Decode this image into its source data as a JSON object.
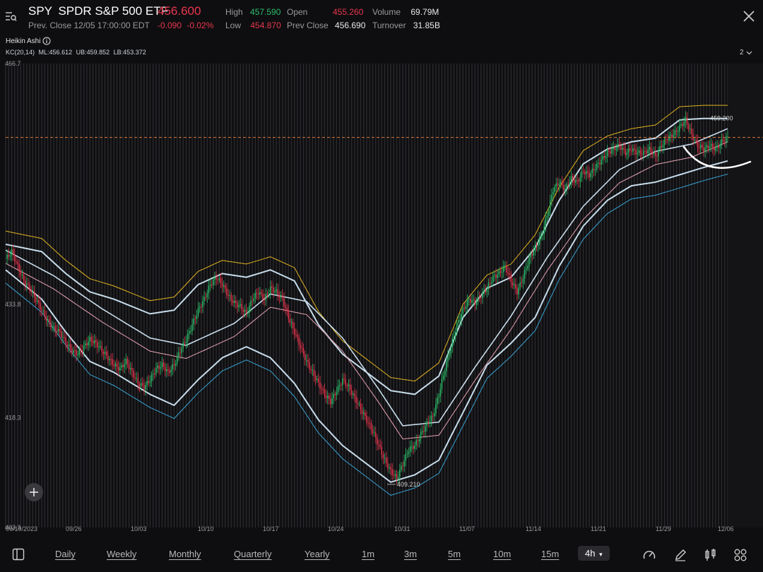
{
  "header": {
    "ticker": "SPY",
    "name": "SPDR S&P 500 ETF",
    "price": "456.600",
    "prev_close_text": "Prev. Close 12/05 17:00:00 EDT",
    "change": "-0.090",
    "change_pct": "-0.02%",
    "stats": {
      "high_label": "High",
      "high": "457.590",
      "low_label": "Low",
      "low": "454.870",
      "open_label": "Open",
      "open": "455.260",
      "prev_close_label": "Prev Close",
      "prev_close": "456.690",
      "volume_label": "Volume",
      "volume": "69.79M",
      "turnover_label": "Turnover",
      "turnover": "31.85B"
    }
  },
  "indicators": {
    "heikin_label": "Heikin Ashi",
    "kc_name": "KC(20,14)",
    "kc_ml": "ML:456.612",
    "kc_ub": "UB:459.852",
    "kc_lb": "LB:453.372",
    "pane_count": "2"
  },
  "chart_data": {
    "type": "candlestick",
    "style": "Heikin Ashi",
    "interval": "4h",
    "y_ticks": [
      "466.7",
      "433.8",
      "418.3",
      "403.3"
    ],
    "y_tick_values": [
      466.7,
      433.8,
      418.3,
      403.3
    ],
    "ylim": [
      403.3,
      466.7
    ],
    "x_ticks": [
      "09/19/2023",
      "09/26",
      "10/03",
      "10/10",
      "10/17",
      "10/24",
      "10/31",
      "11/07",
      "11/14",
      "11/21",
      "11/29",
      "12/06"
    ],
    "price_line": 456.6,
    "annotations": {
      "max_label": "459.200",
      "min_label": "409.210"
    },
    "close_path": [
      [
        0,
        440
      ],
      [
        1,
        441
      ],
      [
        2,
        439
      ],
      [
        3,
        437
      ],
      [
        4,
        436
      ],
      [
        5,
        434.5
      ],
      [
        6,
        433
      ],
      [
        7,
        431.5
      ],
      [
        8,
        430.5
      ],
      [
        9,
        430
      ],
      [
        10,
        428.5
      ],
      [
        11,
        427.5
      ],
      [
        12,
        427
      ],
      [
        13,
        428
      ],
      [
        14,
        429
      ],
      [
        15,
        428.5
      ],
      [
        16,
        427.5
      ],
      [
        17,
        426.5
      ],
      [
        18,
        425.5
      ],
      [
        19,
        425
      ],
      [
        20,
        426
      ],
      [
        21,
        424.5
      ],
      [
        22,
        423
      ],
      [
        23,
        422.5
      ],
      [
        24,
        423.5
      ],
      [
        25,
        425
      ],
      [
        26,
        425.5
      ],
      [
        27,
        424.5
      ],
      [
        28,
        425.5
      ],
      [
        29,
        427.5
      ],
      [
        30,
        429
      ],
      [
        31,
        431
      ],
      [
        32,
        433
      ],
      [
        33,
        434.5
      ],
      [
        34,
        436.5
      ],
      [
        35,
        437.5
      ],
      [
        36,
        436.5
      ],
      [
        37,
        435
      ],
      [
        38,
        434
      ],
      [
        39,
        433.5
      ],
      [
        40,
        432.5
      ],
      [
        41,
        434.5
      ],
      [
        42,
        435.5
      ],
      [
        43,
        434.5
      ],
      [
        44,
        436
      ],
      [
        45,
        435.5
      ],
      [
        46,
        434.5
      ],
      [
        47,
        432
      ],
      [
        48,
        430
      ],
      [
        49,
        428
      ],
      [
        50,
        426
      ],
      [
        51,
        424.5
      ],
      [
        52,
        423
      ],
      [
        53,
        421.5
      ],
      [
        54,
        420.5
      ],
      [
        55,
        422
      ],
      [
        56,
        423.5
      ],
      [
        57,
        422.5
      ],
      [
        58,
        421
      ],
      [
        59,
        419.5
      ],
      [
        60,
        418
      ],
      [
        61,
        416.5
      ],
      [
        62,
        414.5
      ],
      [
        63,
        412.5
      ],
      [
        64,
        411
      ],
      [
        65,
        410
      ],
      [
        66,
        412
      ],
      [
        67,
        414
      ],
      [
        68,
        414.5
      ],
      [
        69,
        416
      ],
      [
        70,
        417.5
      ],
      [
        71,
        418.5
      ],
      [
        72,
        421.5
      ],
      [
        73,
        425
      ],
      [
        74,
        428
      ],
      [
        75,
        431
      ],
      [
        76,
        433
      ],
      [
        77,
        434.5
      ],
      [
        78,
        434
      ],
      [
        79,
        435
      ],
      [
        80,
        436
      ],
      [
        81,
        437.5
      ],
      [
        82,
        438
      ],
      [
        83,
        439
      ],
      [
        84,
        437
      ],
      [
        85,
        435.5
      ],
      [
        86,
        437.5
      ],
      [
        87,
        440
      ],
      [
        88,
        441.5
      ],
      [
        89,
        443
      ],
      [
        90,
        446
      ],
      [
        91,
        449.5
      ],
      [
        92,
        450.5
      ],
      [
        93,
        449.5
      ],
      [
        94,
        451
      ],
      [
        95,
        450.5
      ],
      [
        96,
        452
      ],
      [
        97,
        451.5
      ],
      [
        98,
        452.5
      ],
      [
        99,
        453.5
      ],
      [
        100,
        454.5
      ],
      [
        101,
        455
      ],
      [
        102,
        455.5
      ],
      [
        103,
        454.5
      ],
      [
        104,
        455
      ],
      [
        105,
        454.5
      ],
      [
        106,
        454.5
      ],
      [
        107,
        455
      ],
      [
        108,
        454
      ],
      [
        109,
        455.5
      ],
      [
        110,
        456.5
      ],
      [
        111,
        457
      ],
      [
        112,
        458
      ],
      [
        113,
        459
      ],
      [
        114,
        457
      ],
      [
        115,
        455.5
      ],
      [
        116,
        455
      ],
      [
        117,
        455.5
      ],
      [
        118,
        455
      ],
      [
        119,
        456
      ],
      [
        120,
        456.6
      ]
    ],
    "middle_line": [
      [
        0,
        440
      ],
      [
        8,
        436.5
      ],
      [
        16,
        432
      ],
      [
        24,
        428
      ],
      [
        30,
        427
      ],
      [
        38,
        430
      ],
      [
        44,
        434
      ],
      [
        50,
        433
      ],
      [
        56,
        428
      ],
      [
        62,
        421
      ],
      [
        66,
        416
      ],
      [
        72,
        416.5
      ],
      [
        78,
        424
      ],
      [
        84,
        431
      ],
      [
        90,
        439
      ],
      [
        96,
        446
      ],
      [
        102,
        451
      ],
      [
        108,
        453.5
      ],
      [
        114,
        454.5
      ],
      [
        120,
        456.6
      ]
    ],
    "upper_band": [
      [
        0,
        442
      ],
      [
        6,
        441
      ],
      [
        10,
        438
      ],
      [
        14,
        435.5
      ],
      [
        18,
        434.5
      ],
      [
        24,
        432.5
      ],
      [
        28,
        433
      ],
      [
        32,
        436.5
      ],
      [
        36,
        438
      ],
      [
        40,
        437.5
      ],
      [
        44,
        438.5
      ],
      [
        48,
        437
      ],
      [
        52,
        431
      ],
      [
        56,
        427
      ],
      [
        60,
        424.5
      ],
      [
        64,
        422
      ],
      [
        68,
        421.5
      ],
      [
        72,
        424
      ],
      [
        76,
        432
      ],
      [
        80,
        436
      ],
      [
        84,
        437.5
      ],
      [
        88,
        441.5
      ],
      [
        92,
        448
      ],
      [
        96,
        453
      ],
      [
        100,
        455
      ],
      [
        104,
        456
      ],
      [
        108,
        456.5
      ],
      [
        112,
        459
      ],
      [
        116,
        459.2
      ],
      [
        120,
        459.2
      ]
    ],
    "lower_band": [
      [
        0,
        438.5
      ],
      [
        6,
        434.5
      ],
      [
        10,
        430
      ],
      [
        14,
        426
      ],
      [
        18,
        424.5
      ],
      [
        24,
        421.5
      ],
      [
        28,
        420
      ],
      [
        32,
        423.5
      ],
      [
        36,
        426.5
      ],
      [
        40,
        428
      ],
      [
        44,
        426.5
      ],
      [
        48,
        423
      ],
      [
        52,
        418
      ],
      [
        56,
        414.5
      ],
      [
        60,
        412
      ],
      [
        64,
        409.5
      ],
      [
        68,
        410.5
      ],
      [
        72,
        412.5
      ],
      [
        76,
        419
      ],
      [
        80,
        425.5
      ],
      [
        84,
        428.5
      ],
      [
        88,
        432
      ],
      [
        92,
        439
      ],
      [
        96,
        444.5
      ],
      [
        100,
        448
      ],
      [
        104,
        450
      ],
      [
        108,
        450.5
      ],
      [
        112,
        451.5
      ],
      [
        116,
        452.5
      ],
      [
        120,
        453.4
      ]
    ],
    "colors": {
      "up": "#2ebd6b",
      "down": "#e8364e",
      "band": "#c7dceb",
      "outer_upper": "#e0b321",
      "outer_lower": "#3aa3d4",
      "midline": "#e8a4b4",
      "price_line": "#d9783a"
    }
  },
  "periods": [
    "Daily",
    "Weekly",
    "Monthly",
    "Quarterly",
    "Yearly",
    "1m",
    "3m",
    "5m",
    "10m",
    "15m"
  ],
  "active_period": "4h",
  "tools": [
    "speedometer-icon",
    "pencil-icon",
    "indicator-icon",
    "grid-icon"
  ]
}
